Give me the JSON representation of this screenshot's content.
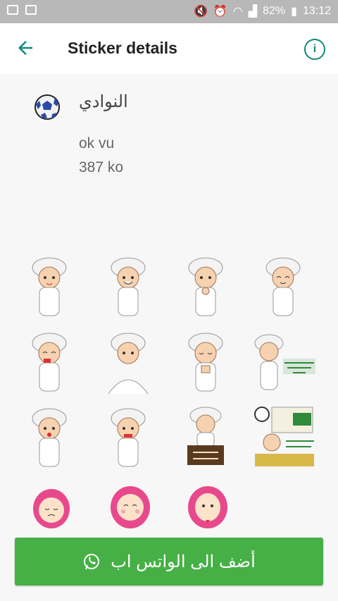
{
  "status": {
    "battery": "82%",
    "time": "13:12"
  },
  "header": {
    "title": "Sticker details"
  },
  "pack": {
    "name": "النوادي",
    "author": "ok vu",
    "size": "387 ko"
  },
  "add_button": {
    "label": "أضف الى الواتس اب"
  },
  "colors": {
    "accent": "#0f8a7a",
    "button": "#46b046"
  }
}
